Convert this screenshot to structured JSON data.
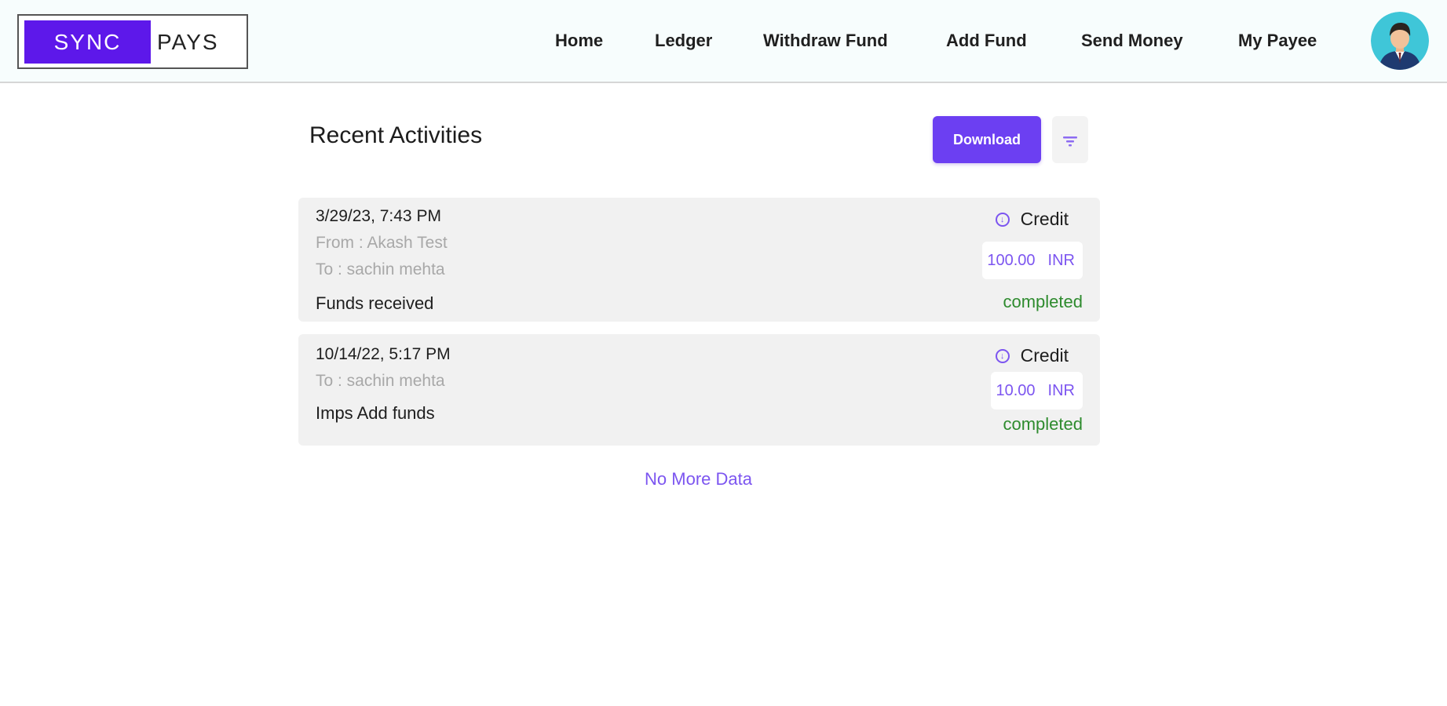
{
  "header": {
    "logo": {
      "sync": "SYNC",
      "pays": "PAYS"
    },
    "nav": [
      {
        "label": "Home"
      },
      {
        "label": "Ledger"
      },
      {
        "label": "Withdraw Fund"
      },
      {
        "label": "Add Fund"
      },
      {
        "label": "Send Money"
      },
      {
        "label": "My Payee"
      }
    ],
    "avatar_icon": "user-avatar-icon"
  },
  "main": {
    "title": "Recent Activities",
    "download_label": "Download",
    "filter_icon": "filter-icon",
    "transactions": [
      {
        "datetime": "3/29/23, 7:43 PM",
        "from": "From : Akash Test",
        "to": "To : sachin mehta",
        "description": "Funds received",
        "type": "Credit",
        "amount": "100.00",
        "currency": "INR",
        "status": "completed"
      },
      {
        "datetime": "10/14/22, 5:17 PM",
        "to": "To : sachin mehta",
        "description": "Imps Add funds",
        "type": "Credit",
        "amount": "10.00",
        "currency": "INR",
        "status": "completed"
      }
    ],
    "no_more": "No More Data"
  },
  "colors": {
    "accent": "#6c3ff2",
    "brand": "#5d18ea",
    "status_completed": "#2e8b2e",
    "card_bg": "#f1f1f1"
  }
}
